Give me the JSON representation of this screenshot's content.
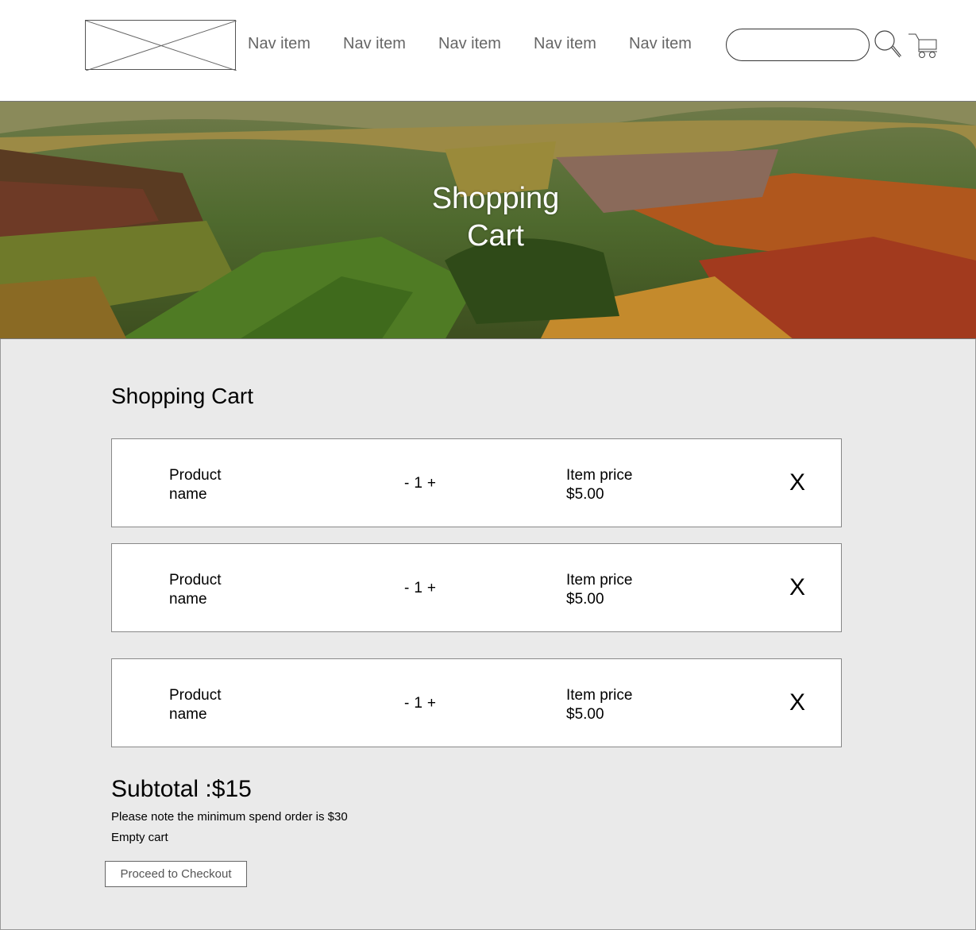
{
  "header": {
    "logo_label": "logo placeholder",
    "nav_items": [
      "Nav item",
      "Nav item",
      "Nav item",
      "Nav item",
      "Nav item"
    ],
    "search": {
      "value": "",
      "placeholder": ""
    },
    "icons": {
      "search": "search-icon",
      "cart": "cart-icon"
    }
  },
  "hero": {
    "title_line1": "Shopping",
    "title_line2": "Cart"
  },
  "cart": {
    "title": "Shopping Cart",
    "items": [
      {
        "name_line1": "Product",
        "name_line2": "name",
        "minus": "-",
        "quantity": "1",
        "plus": "+",
        "price_label": "Item price",
        "price": "$5.00",
        "remove": "X"
      },
      {
        "name_line1": "Product",
        "name_line2": "name",
        "minus": "-",
        "quantity": "1",
        "plus": "+",
        "price_label": "Item price",
        "price": "$5.00",
        "remove": "X"
      },
      {
        "name_line1": "Product",
        "name_line2": "name",
        "minus": "-",
        "quantity": "1",
        "plus": "+",
        "price_label": "Item price",
        "price": "$5.00",
        "remove": "X"
      }
    ],
    "subtotal": "Subtotal :$15",
    "note": "Please note the minimum spend order is $30",
    "empty_cart": "Empty cart",
    "checkout": "Proceed to Checkout"
  },
  "colors": {
    "content_bg": "#eaeaea",
    "nav_text": "#666666",
    "hero_text": "#ffffff"
  }
}
